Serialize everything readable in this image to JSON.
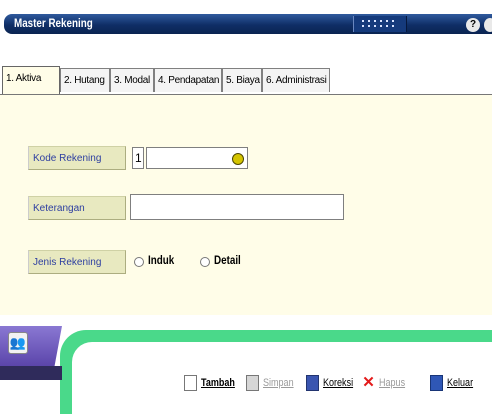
{
  "window": {
    "title": "Master Rekening"
  },
  "tabs": [
    {
      "label": "1. Aktiva",
      "active": true
    },
    {
      "label": "2. Hutang",
      "active": false
    },
    {
      "label": "3. Modal",
      "active": false
    },
    {
      "label": "4. Pendapatan",
      "active": false
    },
    {
      "label": "5. Biaya",
      "active": false
    },
    {
      "label": "6. Administrasi",
      "active": false
    }
  ],
  "form": {
    "kode_label": "Kode Rekening",
    "kode_prefix": "1",
    "kode_value": "",
    "keterangan_label": "Keterangan",
    "keterangan_value": "",
    "jenis_label": "Jenis Rekening",
    "radio_induk": "Induk",
    "radio_detail": "Detail"
  },
  "toolbar": {
    "tambah": "Tambah",
    "simpan": "Simpan",
    "koreksi": "Koreksi",
    "hapus": "Hapus",
    "keluar": "Keluar"
  },
  "colors": {
    "title_bar": "#0f2e66",
    "panel_bg": "#fffde8",
    "label_bg": "#e8e9c0",
    "label_text": "#2d3ea0",
    "green_band": "#4ad98a",
    "purple_block": "#6d5abf"
  },
  "icons": {
    "help": "question-icon",
    "lookup": "search-lookup-icon",
    "users": "users-icon"
  }
}
